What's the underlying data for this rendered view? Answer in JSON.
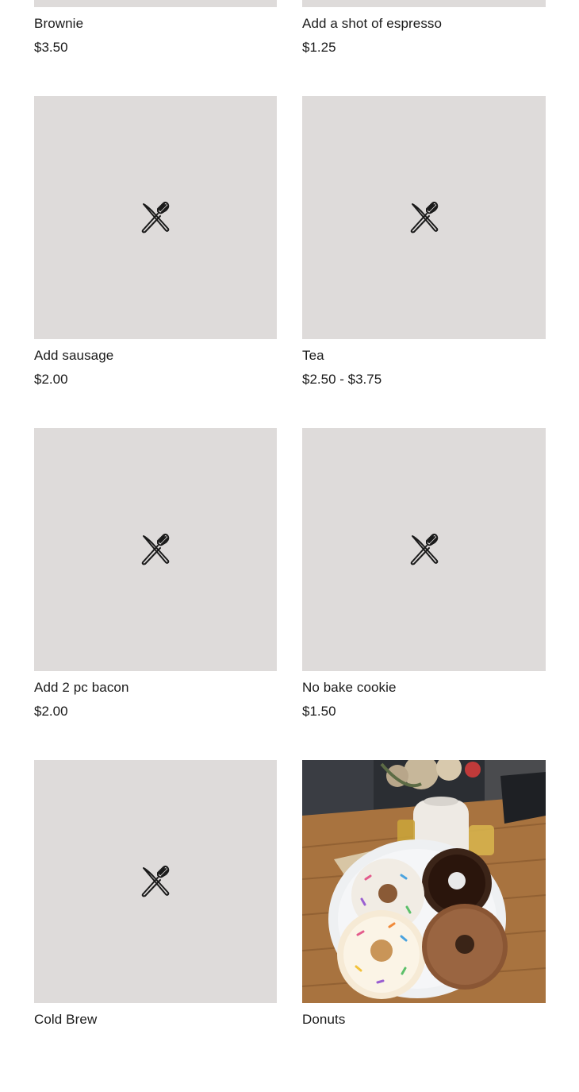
{
  "menu_items": [
    {
      "name": "Brownie",
      "price": "$3.50",
      "image": "placeholder-utensils-icon"
    },
    {
      "name": "Add a shot of espresso",
      "price": "$1.25",
      "image": "placeholder-utensils-icon"
    },
    {
      "name": "Add sausage",
      "price": "$2.00",
      "image": "placeholder-utensils-icon"
    },
    {
      "name": "Tea",
      "price": "$2.50 - $3.75",
      "image": "placeholder-utensils-icon"
    },
    {
      "name": "Add 2 pc bacon",
      "price": "$2.00",
      "image": "placeholder-utensils-icon"
    },
    {
      "name": "No bake cookie",
      "price": "$1.50",
      "image": "placeholder-utensils-icon"
    },
    {
      "name": "Cold Brew",
      "price": "",
      "image": "placeholder-utensils-icon"
    },
    {
      "name": "Donuts",
      "price": "",
      "image": "donuts-photo"
    }
  ],
  "colors": {
    "placeholder_bg": "#dedbda",
    "text": "#1a1a1a",
    "icon_stroke": "#1a1a1a"
  }
}
